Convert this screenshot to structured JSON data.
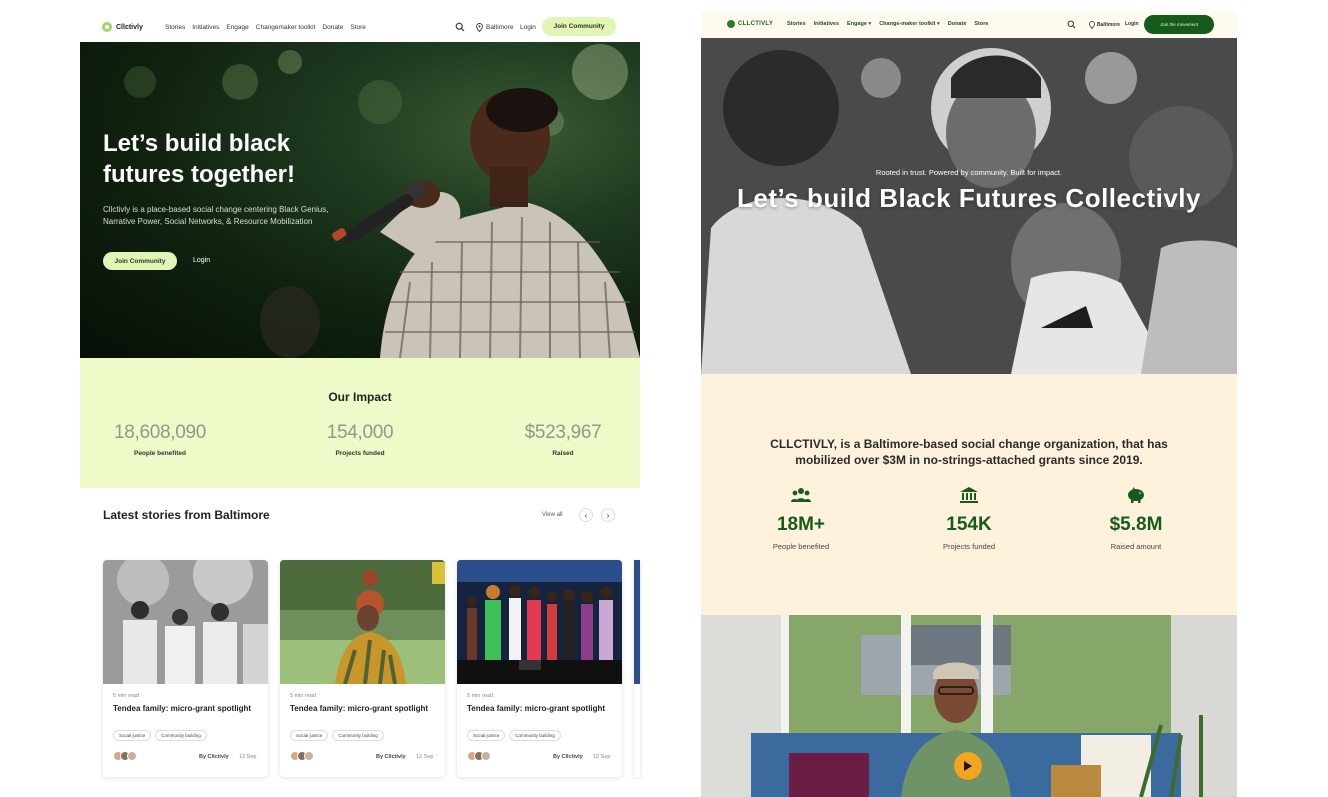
{
  "left": {
    "nav": {
      "logo": "Cllctivly",
      "menu": [
        "Stories",
        "Initiatives",
        "Engage",
        "Changemaker toolkit",
        "Donate",
        "Store"
      ],
      "location": "Baltimore",
      "login": "Login",
      "join": "Join Community"
    },
    "hero": {
      "title": "Let’s build black futures together!",
      "body": "Cllctivly is a place-based social change centering Black Genius, Narrative Power, Social Networks, & Resource Mobilization",
      "join": "Join Community",
      "login": "Login"
    },
    "impact": {
      "title": "Our Impact",
      "stats": [
        {
          "value": "18,608,090",
          "label": "People benefited"
        },
        {
          "value": "154,000",
          "label": "Projects funded"
        },
        {
          "value": "$523,967",
          "label": "Raised"
        }
      ]
    },
    "stories": {
      "title": "Latest stories from Baltimore",
      "view_all": "View all",
      "prev": "‹",
      "next": "›",
      "cards": [
        {
          "read": "5 min read",
          "title": "Tendea family: micro-grant spotlight",
          "tags": [
            "Social justice",
            "Community building"
          ],
          "author": "By Cllctivly",
          "date": "12 Sep"
        },
        {
          "read": "5 min read",
          "title": "Tendea family: micro-grant spotlight",
          "tags": [
            "Social justice",
            "Community building"
          ],
          "author": "By Cllctivly",
          "date": "12 Sep"
        },
        {
          "read": "5 min read",
          "title": "Tendea family: micro-grant spotlight",
          "tags": [
            "Social justice",
            "Community building"
          ],
          "author": "By Cllctivly",
          "date": "12 Sep"
        }
      ]
    }
  },
  "right": {
    "nav": {
      "logo": "CLLCTIVLY",
      "menu": [
        "Stories",
        "Initiatives",
        "Engage",
        "Change-maker toolkit",
        "Donate",
        "Store"
      ],
      "location": "Baltimore",
      "login": "Login",
      "join": "Join the movement"
    },
    "hero": {
      "kicker": "Rooted in trust. Powered by community. Built for impact.",
      "title": "Let’s build Black Futures Collectivly"
    },
    "mission": {
      "text": "CLLCTIVLY, is a Baltimore-based social change organization, that has mobilized over $3M in no-strings-attached grants since 2019.",
      "stats": [
        {
          "icon": "people-icon",
          "value": "18M+",
          "label": "People benefited"
        },
        {
          "icon": "bank-icon",
          "value": "154K",
          "label": "Projects funded"
        },
        {
          "icon": "piggy-bank-icon",
          "value": "$5.8M",
          "label": "Raised amount"
        }
      ]
    }
  },
  "colors": {
    "left_accent": "#e3f4b7",
    "left_impact_bg": "#eefbc9",
    "right_brand": "#155c1a",
    "right_cream": "#fff2dd",
    "play_button": "#f1a61e"
  }
}
